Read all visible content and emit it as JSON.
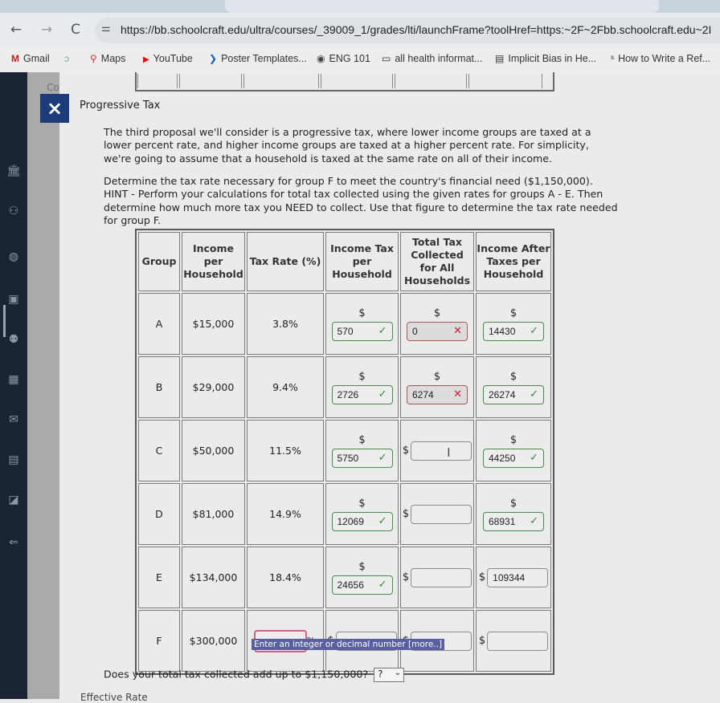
{
  "browser": {
    "url": "https://bb.schoolcraft.edu/ultra/courses/_39009_1/grades/lti/launchFrame?toolHref=https:~2F~2Fbb.schoolcraft.edu~2I",
    "nav": {
      "back": "←",
      "forward": "→",
      "reload": "C"
    },
    "bookmarks": [
      {
        "icon": "gmail-icon",
        "glyph": "M",
        "label": "Gmail"
      },
      {
        "icon": "app-icon",
        "glyph": "ↄ",
        "label": ""
      },
      {
        "icon": "maps-icon",
        "glyph": "⚲",
        "label": "Maps"
      },
      {
        "icon": "youtube-icon",
        "glyph": "▶",
        "label": "YouTube"
      },
      {
        "icon": "poster-icon",
        "glyph": "❯",
        "label": "Poster Templates..."
      },
      {
        "icon": "globe-icon",
        "glyph": "◉",
        "label": "ENG 101"
      },
      {
        "icon": "folder-icon",
        "glyph": "▭",
        "label": "all health informat..."
      },
      {
        "icon": "doc-icon",
        "glyph": "▤",
        "label": "Implicit Bias in He..."
      },
      {
        "icon": "scribbr-icon",
        "glyph": "ˢ",
        "label": "How to Write a Ref..."
      }
    ]
  },
  "page": {
    "close_label": "×",
    "crumb": "Co",
    "title": "Progressive Tax",
    "intro": "The third proposal we'll consider is a progressive tax, where lower income groups are taxed at a lower percent rate, and higher income groups are taxed at a higher percent rate. For simplicity, we're going to assume that a household is taxed at the same rate on all of their income.",
    "instructions": "Determine the tax rate necessary for group F to meet the country's financial need ($1,150,000). HINT - Perform your calculations for total tax collected using the given rates for groups A - E. Then determine how much more tax you NEED to collect. Use that figure to determine the tax rate needed for group F.",
    "table": {
      "headers": [
        "Group",
        "Income per Household",
        "Tax Rate (%)",
        "Income Tax per Household",
        "Total Tax Collected for All Households",
        "Income After Taxes per Household"
      ],
      "rows": [
        {
          "group": "A",
          "income": "$15,000",
          "rate": "3.8%",
          "tax": "570",
          "tax_status": "correct",
          "total": "0",
          "total_status": "incorrect",
          "after": "14430",
          "after_status": "correct"
        },
        {
          "group": "B",
          "income": "$29,000",
          "rate": "9.4%",
          "tax": "2726",
          "tax_status": "correct",
          "total": "6274",
          "total_status": "incorrect",
          "after": "26274",
          "after_status": "correct"
        },
        {
          "group": "C",
          "income": "$50,000",
          "rate": "11.5%",
          "tax": "5750",
          "tax_status": "correct",
          "total": "",
          "total_status": "empty",
          "after": "44250",
          "after_status": "correct"
        },
        {
          "group": "D",
          "income": "$81,000",
          "rate": "14.9%",
          "tax": "12069",
          "tax_status": "correct",
          "total": "",
          "total_status": "empty",
          "after": "68931",
          "after_status": "correct"
        },
        {
          "group": "E",
          "income": "$134,000",
          "rate": "18.4%",
          "tax": "24656",
          "tax_status": "correct",
          "total": "",
          "total_status": "empty",
          "after": "109344",
          "after_status": "ungraded"
        },
        {
          "group": "F",
          "income": "$300,000",
          "rate": "",
          "tax": "",
          "total": "",
          "after": ""
        }
      ],
      "currency": "$",
      "percent": "%",
      "check": "✓",
      "cross": "✕"
    },
    "tooltip": "Enter an integer or decimal number [more..]",
    "question": "Does your total tax collected add up to $1,150,000?",
    "question_select": "?",
    "next_section": "Effective Rate"
  }
}
